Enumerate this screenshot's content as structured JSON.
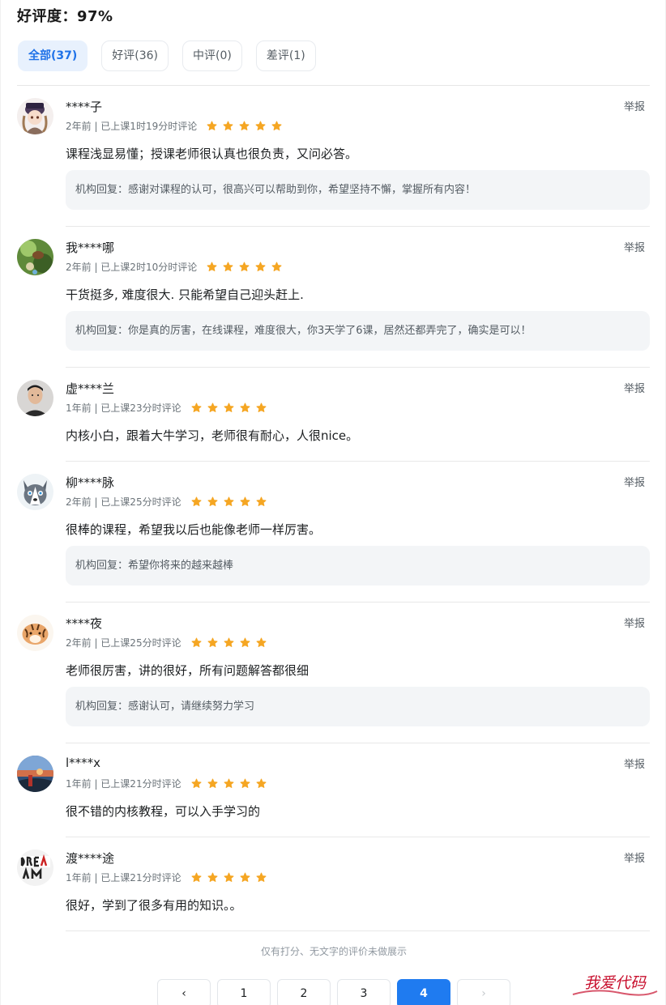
{
  "summary": {
    "rating_text": "好评度：97%"
  },
  "tabs": [
    {
      "label": "全部(37)",
      "active": true
    },
    {
      "label": "好评(36)",
      "active": false
    },
    {
      "label": "中评(0)",
      "active": false
    },
    {
      "label": "差评(1)",
      "active": false
    }
  ],
  "report_label": "举报",
  "reviews": [
    {
      "name": "****子",
      "meta": "2年前 | 已上课1时19分时评论",
      "stars": 5,
      "content": "课程浅显易懂；授课老师很认真也很负责，又问必答。",
      "reply": "机构回复：感谢对课程的认可，很高兴可以帮助到你，希望坚持不懈，掌握所有内容！",
      "avatar_icon": "anime-girl-avatar"
    },
    {
      "name": "我****哪",
      "meta": "2年前 | 已上课2时10分时评论",
      "stars": 5,
      "content": "干货挺多, 难度很大. 只能希望自己迎头赶上.",
      "reply": "机构回复：你是真的厉害，在线课程，难度很大，你3天学了6课，居然还都弄完了，确实是可以！",
      "avatar_icon": "nature-avatar"
    },
    {
      "name": "虚****兰",
      "meta": "1年前 | 已上课23分时评论",
      "stars": 5,
      "content": "内核小白，跟着大牛学习，老师很有耐心，人很nice。",
      "reply": "",
      "avatar_icon": "person-photo-avatar"
    },
    {
      "name": "柳****脉",
      "meta": "2年前 | 已上课25分时评论",
      "stars": 5,
      "content": "很棒的课程，希望我以后也能像老师一样厉害。",
      "reply": "机构回复：希望你将来的越来越棒",
      "avatar_icon": "husky-avatar"
    },
    {
      "name": "****夜",
      "meta": "2年前 | 已上课25分时评论",
      "stars": 5,
      "content": "老师很厉害，讲的很好，所有问题解答都很细",
      "reply": "机构回复：感谢认可，请继续努力学习",
      "avatar_icon": "tiger-avatar"
    },
    {
      "name": "l****x",
      "meta": "1年前 | 已上课21分时评论",
      "stars": 5,
      "content": "很不错的内核教程，可以入手学习的",
      "reply": "",
      "avatar_icon": "sunset-avatar"
    },
    {
      "name": "渡****途",
      "meta": "1年前 | 已上课21分时评论",
      "stars": 5,
      "content": "很好，学到了很多有用的知识。。",
      "reply": "",
      "avatar_icon": "dream-text-avatar"
    }
  ],
  "footer_note": "仅有打分、无文字的评价未做展示",
  "pagination": {
    "prev": "‹",
    "pages": [
      "1",
      "2",
      "3",
      "4"
    ],
    "current": "4",
    "next": "›"
  },
  "watermark_text": "我爱代码",
  "colors": {
    "accent": "#1f7bf0",
    "star": "#f5a623",
    "reply_bg": "#f3f5f7"
  }
}
